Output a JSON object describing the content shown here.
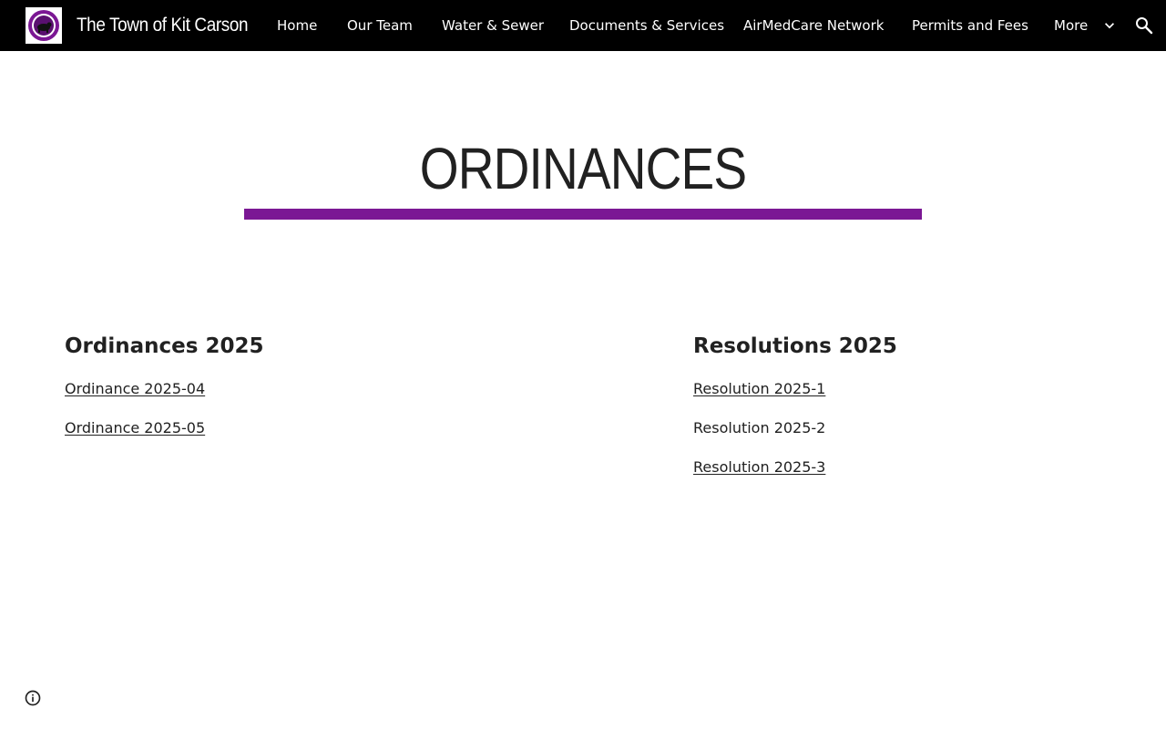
{
  "header": {
    "site_title": "The Town of Kit Carson",
    "logo_icon": "town-seal-icon",
    "nav": [
      {
        "label": "Home"
      },
      {
        "label": "Our Team"
      },
      {
        "label": "Water & Sewer"
      },
      {
        "label": "Documents & Services"
      },
      {
        "label": "AirMedCare Network"
      },
      {
        "label": "Permits and Fees"
      },
      {
        "label": "More"
      }
    ],
    "more_icon": "chevron-down-icon",
    "search_icon": "search-icon"
  },
  "main": {
    "title": "ORDINANCES",
    "accent_color": "#7b1794",
    "ordinances": {
      "heading": "Ordinances 2025",
      "items": [
        {
          "label": "Ordinance 2025-04",
          "link": true
        },
        {
          "label": "Ordinance 2025-05",
          "link": true
        }
      ]
    },
    "resolutions": {
      "heading": "Resolutions 2025",
      "items": [
        {
          "label": "Resolution 2025-1",
          "link": true
        },
        {
          "label": "Resolution 2025-2",
          "link": false
        },
        {
          "label": "Resolution 2025-3",
          "link": true
        }
      ]
    }
  },
  "footer": {
    "info_icon": "info-icon"
  }
}
